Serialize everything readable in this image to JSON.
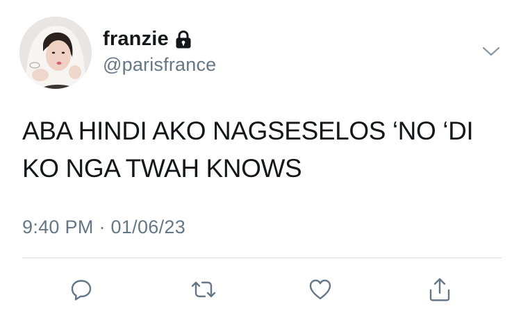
{
  "tweet": {
    "display_name": "franzie",
    "handle": "@parisfrance",
    "text": "ABA HINDI AKO NAGSESELOS ‘NO ‘DI\nKO NGA TWAH KNOWS",
    "timestamp": "9:40 PM · 01/06/23",
    "protected_account_icon": "lock-icon",
    "menu_icon": "chevron-down-icon"
  },
  "actions": [
    {
      "name": "reply",
      "icon": "reply-icon"
    },
    {
      "name": "retweet",
      "icon": "retweet-icon"
    },
    {
      "name": "like",
      "icon": "heart-icon"
    },
    {
      "name": "share",
      "icon": "share-icon"
    }
  ],
  "colors": {
    "text": "#14171a",
    "secondary": "#657786",
    "icon": "#657786",
    "divider": "#dadde0"
  }
}
